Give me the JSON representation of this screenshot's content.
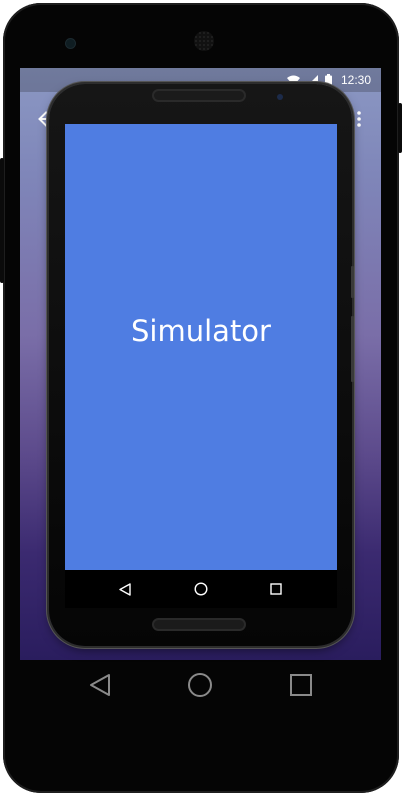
{
  "status_bar": {
    "time": "12:30",
    "icons": [
      "wifi-icon",
      "signal-icon",
      "battery-icon"
    ]
  },
  "toolbar": {
    "back_icon": "back-arrow-icon",
    "overflow_icon": "overflow-menu-icon"
  },
  "inner_device": {
    "screen_label": "Simulator",
    "screen_color": "#4f7de2",
    "nav_icons": [
      "back-triangle-icon",
      "home-circle-icon",
      "recents-square-icon"
    ]
  },
  "outer_nav": {
    "icons": [
      "back-triangle-icon",
      "home-circle-icon",
      "recents-square-icon"
    ]
  },
  "colors": {
    "device_body": "#050505",
    "wallpaper_top": "#8b98c3",
    "wallpaper_bottom": "#2a1d5e"
  }
}
